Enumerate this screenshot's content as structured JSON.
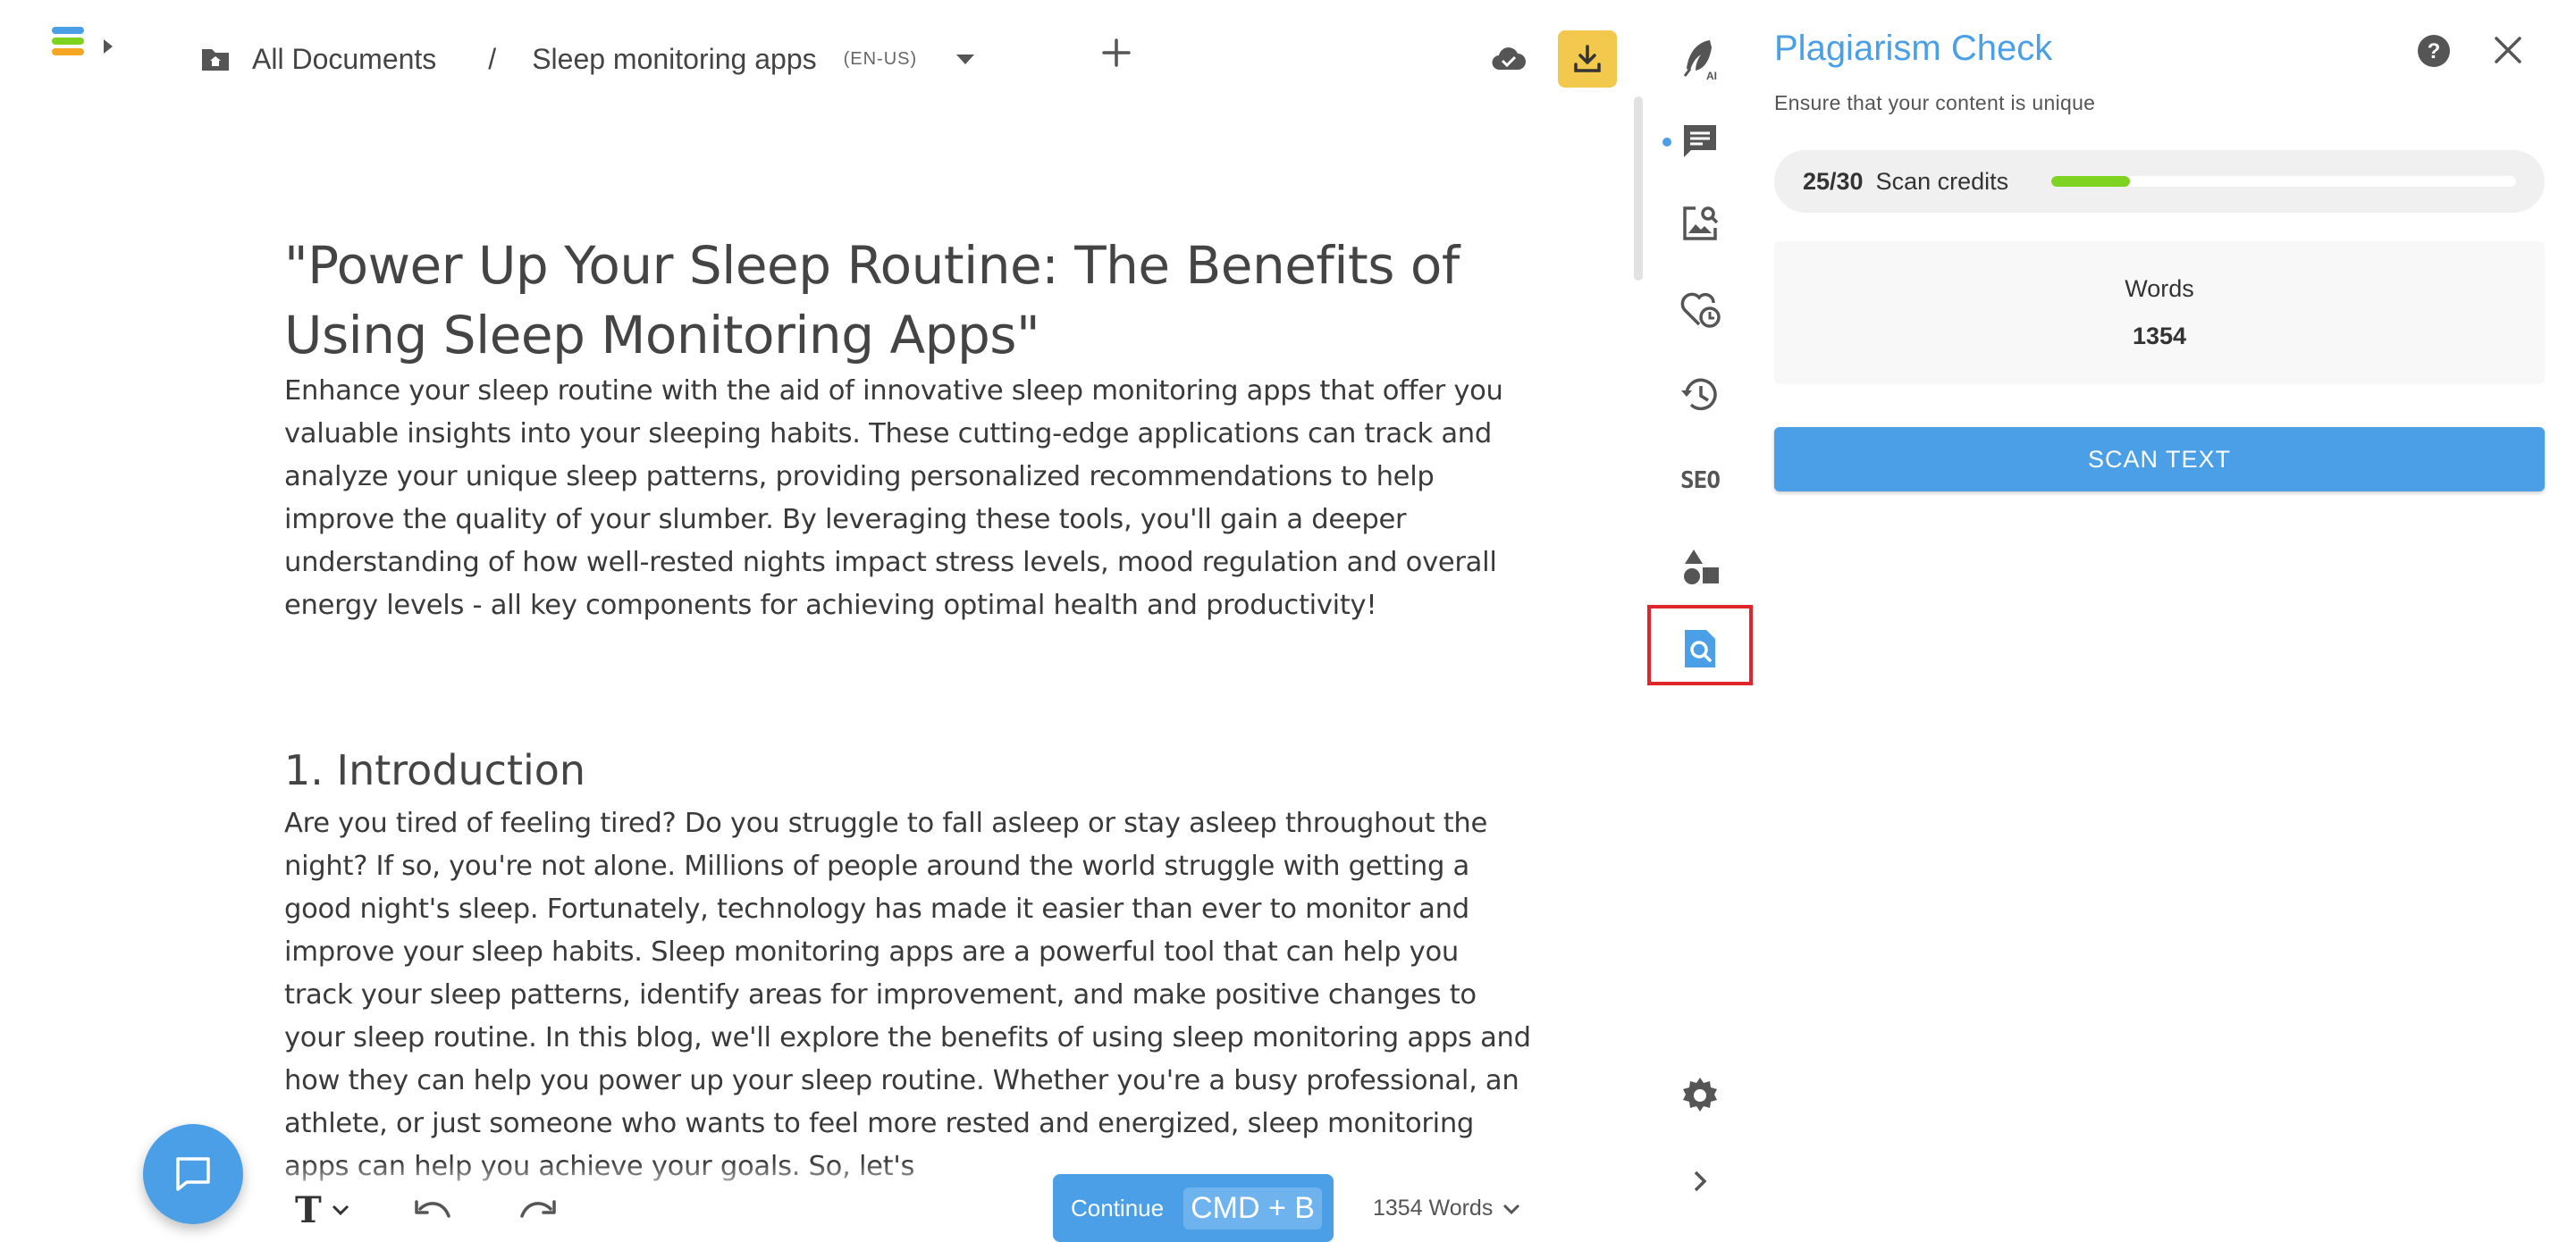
{
  "header": {
    "breadcrumb_root": "All Documents",
    "breadcrumb_separator": "/",
    "document_name": "Sleep monitoring apps",
    "language": "(EN-US)"
  },
  "document": {
    "title": "\"Power Up Your Sleep Routine: The Benefits of Using Sleep Monitoring Apps\"",
    "intro": "Enhance your sleep routine with the aid of innovative sleep monitoring apps that offer you valuable insights into your sleeping habits. These cutting-edge applications can track and analyze your unique sleep patterns, providing personalized recommendations to help improve the quality of your slumber. By leveraging these tools, you'll gain a deeper understanding of how well-rested nights impact stress levels, mood regulation and overall energy levels - all key components for achieving optimal health and productivity!",
    "section_heading": "1. Introduction",
    "section_body": "Are you tired of feeling tired? Do you struggle to fall asleep or stay asleep throughout the night? If so, you're not alone. Millions of people around the world struggle with getting a good night's sleep. Fortunately, technology has made it easier than ever to monitor and improve your sleep habits. Sleep monitoring apps are a powerful tool that can help you track your sleep patterns, identify areas for improvement, and make positive changes to your sleep routine. In this blog, we'll explore the benefits of using sleep monitoring apps and how they can help you power up your sleep routine. Whether you're a busy professional, an athlete, or just someone who wants to feel more rested and energized, sleep monitoring apps can help you achieve your goals. So, let's"
  },
  "bottom_bar": {
    "continue_label": "Continue",
    "continue_shortcut": "CMD + B",
    "word_count": "1354 Words"
  },
  "rail": {
    "seo_label": "SEO"
  },
  "panel": {
    "title": "Plagiarism Check",
    "subtitle": "Ensure that your content is unique",
    "credits_count": "25/30",
    "credits_label": "Scan credits",
    "credits_used_fraction": 0.17,
    "words_label": "Words",
    "words_value": "1354",
    "scan_button": "SCAN TEXT"
  },
  "colors": {
    "accent": "#4a9fe6",
    "download": "#f2c94c",
    "progress": "#7ed321",
    "highlight": "#e0262b",
    "logo_blue": "#4a9fe6",
    "logo_green": "#7ed321",
    "logo_orange": "#f5a623"
  },
  "icons": [
    "app-logo",
    "folder-home-icon",
    "chevron-down-icon",
    "plus-icon",
    "cloud-check-icon",
    "download-icon",
    "ai-quill-icon",
    "comment-icon",
    "image-search-icon",
    "heart-clock-icon",
    "history-icon",
    "seo-icon",
    "shapes-icon",
    "plagiarism-icon",
    "settings-icon",
    "chevron-right-icon",
    "help-icon",
    "close-icon",
    "chat-icon",
    "text-format-icon",
    "undo-icon",
    "redo-icon"
  ]
}
